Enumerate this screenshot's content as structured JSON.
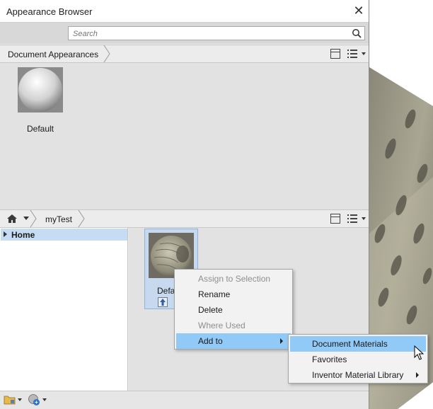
{
  "window": {
    "title": "Appearance Browser"
  },
  "search": {
    "placeholder": "Search"
  },
  "document_bar": {
    "label": "Document Appearances"
  },
  "document_items": [
    {
      "label": "Default"
    }
  ],
  "library_bar": {
    "crumb": "myTest"
  },
  "tree": {
    "items": [
      {
        "label": "Home"
      }
    ]
  },
  "library_items": [
    {
      "label": "Default"
    }
  ],
  "context_menu": {
    "items": [
      {
        "label": "Assign to Selection",
        "enabled": false
      },
      {
        "label": "Rename",
        "enabled": true
      },
      {
        "label": "Delete",
        "enabled": true
      },
      {
        "label": "Where Used",
        "enabled": false
      },
      {
        "label": "Add to",
        "enabled": true,
        "has_submenu": true
      }
    ]
  },
  "submenu": {
    "items": [
      {
        "label": "Document Materials",
        "highlighted": true
      },
      {
        "label": "Favorites"
      },
      {
        "label": "Inventor Material Library",
        "has_submenu": true
      }
    ]
  },
  "colors": {
    "accent": "#91c9f7",
    "selection": "#c7d9ef",
    "tree_selection": "#c6dcf3"
  }
}
